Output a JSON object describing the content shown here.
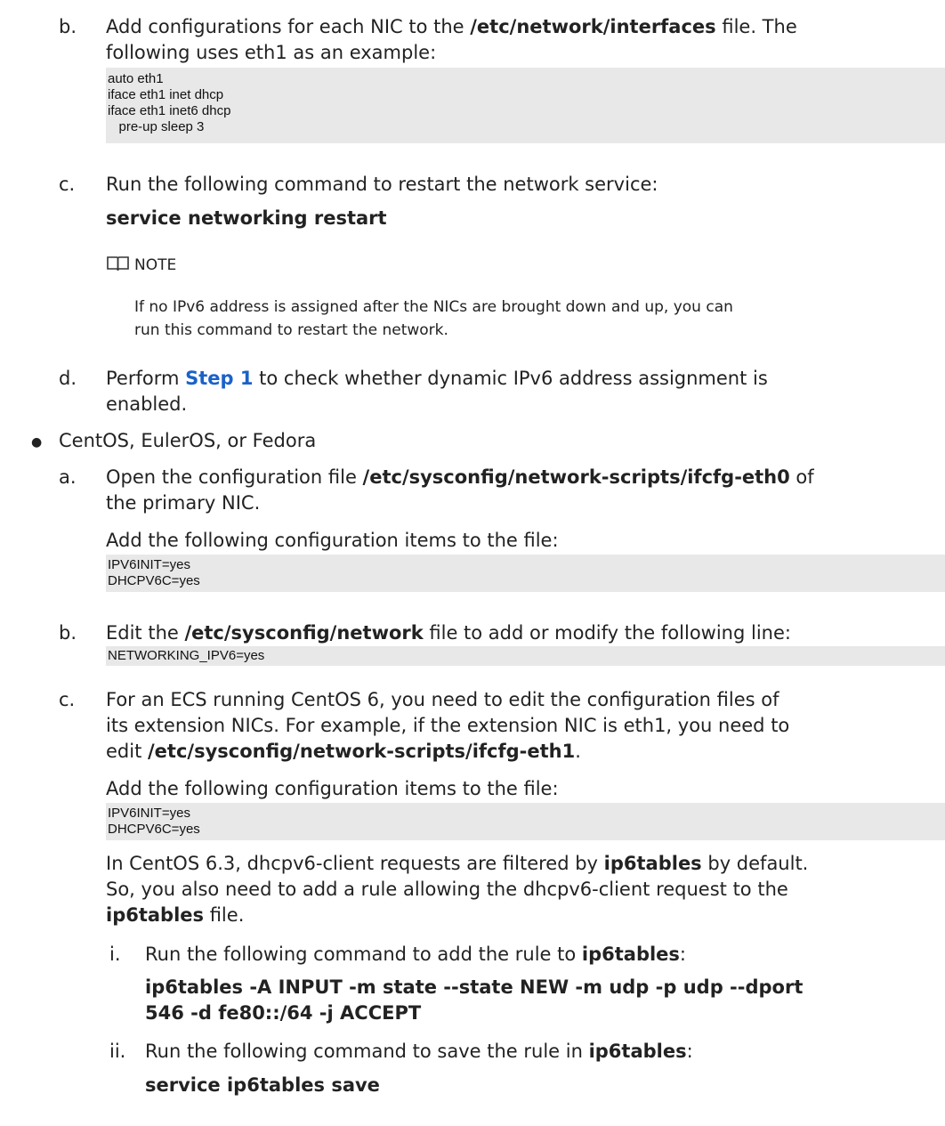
{
  "step_b_ubuntu": {
    "marker": "b.",
    "line1_pre": "Add configurations for each NIC to the ",
    "line1_bold": "/etc/network/interfaces",
    "line1_post": " file. The",
    "line2": "following uses eth1 as an example:",
    "code": [
      "auto eth1",
      "iface eth1 inet dhcp",
      "iface eth1 inet6 dhcp",
      "   pre-up sleep 3"
    ]
  },
  "step_c_ubuntu": {
    "marker": "c.",
    "text": "Run the following command to restart the network service:",
    "command": "service networking restart"
  },
  "note": {
    "label": "NOTE",
    "line1": "If no IPv6 address is assigned after the NICs are brought down and up, you can",
    "line2": "run this command to restart the network."
  },
  "step_d_ubuntu": {
    "marker": "d.",
    "pre": "Perform ",
    "link": "Step 1",
    "post": " to check whether dynamic IPv6 address assignment is",
    "line2": "enabled."
  },
  "bullet_centos": {
    "marker": "●",
    "text": "CentOS, EulerOS, or Fedora"
  },
  "step_a_centos": {
    "marker": "a.",
    "line1_pre": "Open the configuration file ",
    "line1_bold": "/etc/sysconfig/network-scripts/ifcfg-eth0",
    "line1_post": " of",
    "line2": "the primary NIC.",
    "add_text": "Add the following configuration items to the file:",
    "code": [
      "IPV6INIT=yes",
      "DHCPV6C=yes"
    ]
  },
  "step_b_centos": {
    "marker": "b.",
    "pre": "Edit the ",
    "bold": "/etc/sysconfig/network",
    "post": " file to add or modify the following line:",
    "code": [
      "NETWORKING_IPV6=yes"
    ]
  },
  "step_c_centos": {
    "marker": "c.",
    "line1": "For an ECS running CentOS 6, you need to edit the configuration files of",
    "line2": "its extension NICs. For example, if the extension NIC is eth1, you need to",
    "line3_pre": "edit ",
    "line3_bold": "/etc/sysconfig/network-scripts/ifcfg-eth1",
    "line3_post": ".",
    "add_text": "Add the following configuration items to the file:",
    "code": [
      "IPV6INIT=yes",
      "DHCPV6C=yes"
    ],
    "para_line1_pre": "In CentOS 6.3, dhcpv6-client requests are filtered by ",
    "para_line1_bold": "ip6tables",
    "para_line1_post": " by default.",
    "para_line2": "So, you also need to add a rule allowing the dhcpv6-client request to the",
    "para_line3_bold": "ip6tables",
    "para_line3_post": " file."
  },
  "substep_i": {
    "marker": "i.",
    "pre": "Run the following command to add the rule to ",
    "bold": "ip6tables",
    "post": ":",
    "command_line1": "ip6tables -A INPUT -m state --state NEW -m udp -p udp --dport",
    "command_line2": "546 -d fe80::/64 -j ACCEPT"
  },
  "substep_ii": {
    "marker": "ii.",
    "pre": "Run the following command to save the rule in ",
    "bold": "ip6tables",
    "post": ":",
    "command": "service ip6tables save"
  }
}
